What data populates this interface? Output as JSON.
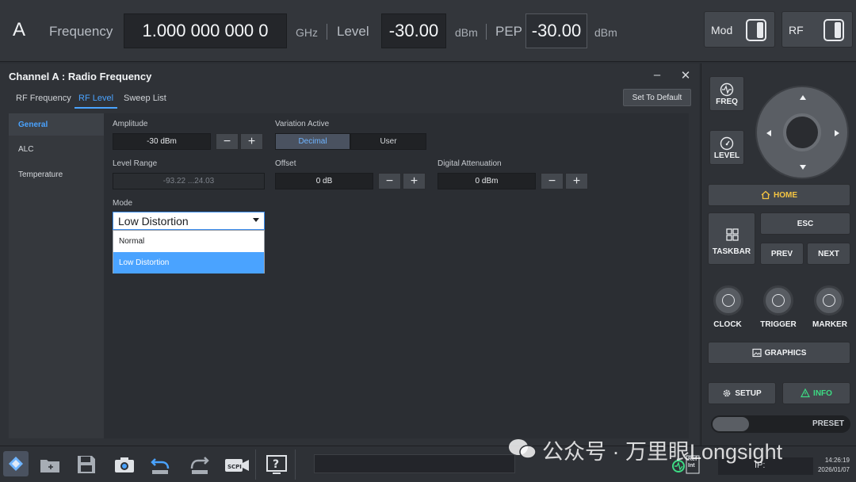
{
  "header": {
    "channel": "A",
    "frequency_label": "Frequency",
    "frequency_value": "1.000 000 000 0",
    "frequency_unit": "GHz",
    "level_label": "Level",
    "level_value": "-30.00",
    "level_unit": "dBm",
    "pep_label": "PEP",
    "pep_value": "-30.00",
    "pep_unit": "dBm",
    "mod_label": "Mod",
    "rf_label": "RF"
  },
  "dialog": {
    "title": "Channel A : Radio Frequency",
    "tabs": [
      {
        "label": "RF Frequency"
      },
      {
        "label": "RF Level"
      },
      {
        "label": "Sweep List"
      }
    ],
    "set_default": "Set To Default",
    "nav": [
      {
        "label": "General"
      },
      {
        "label": "ALC"
      },
      {
        "label": "Temperature"
      }
    ],
    "amplitude_label": "Amplitude",
    "amplitude_value": "-30 dBm",
    "variation_label": "Variation Active",
    "variation_options": [
      "Decimal",
      "User"
    ],
    "level_range_label": "Level Range",
    "level_range_value": "-93.22 ...24.03",
    "offset_label": "Offset",
    "offset_value": "0 dB",
    "digital_att_label": "Digital Attenuation",
    "digital_att_value": "0 dBm",
    "mode_label": "Mode",
    "mode_value": "Low Distortion",
    "mode_options": [
      "Normal",
      "Low Distortion"
    ]
  },
  "right_panel": {
    "freq": "FREQ",
    "level": "LEVEL",
    "home": "HOME",
    "taskbar": "TASKBAR",
    "esc": "ESC",
    "prev": "PREV",
    "next": "NEXT",
    "clock": "CLOCK",
    "trigger": "TRIGGER",
    "marker": "MARKER",
    "graphics": "GRAPHICS",
    "setup": "SETUP",
    "info": "INFO",
    "preset": "PRESET"
  },
  "taskbar": {
    "ip_label": "IP:",
    "time": "14:26:19",
    "date": "2026/01/07",
    "ref_top": "Ref",
    "ref_bottom": "Int"
  },
  "watermark": "公众号 · 万里眼Longsight",
  "colors": {
    "accent": "#4aa3ff",
    "home": "#f5c542",
    "info": "#3ddc84"
  }
}
